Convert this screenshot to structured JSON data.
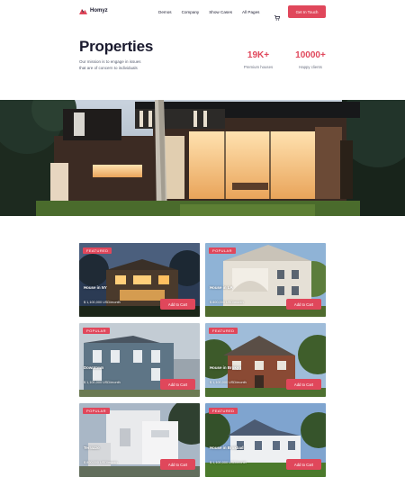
{
  "brand": {
    "name": "Homyz",
    "accent": "#e0475b"
  },
  "nav": {
    "items": [
      "Demos",
      "Company",
      "Show Cases",
      "All Pages"
    ],
    "cart_icon": "cart-icon",
    "cta_label": "Get In Touch"
  },
  "hero": {
    "title": "Properties",
    "mission_line1": "Our mission is to engage in issues",
    "mission_line2": "that are of concern to individuals",
    "stats": [
      {
        "value": "19K+",
        "label": "Premium houses"
      },
      {
        "value": "10000+",
        "label": "Happy clients"
      }
    ]
  },
  "properties": [
    {
      "tag": "FEATURED",
      "name": "House in NY",
      "price": "$ 1,100,000 USD/month",
      "button": "Add to Cart"
    },
    {
      "tag": "POPULAR",
      "name": "House in LA",
      "price": "$ 800,000 USD/month",
      "button": "Add to Cart"
    },
    {
      "tag": "POPULAR",
      "name": "Downtown",
      "price": "$ 1,100,000 USD/month",
      "button": "Add to Cart"
    },
    {
      "tag": "FEATURED",
      "name": "House in Brokyn",
      "price": "$ 1,100,000 USD/month",
      "button": "Add to Cart"
    },
    {
      "tag": "POPULAR",
      "name": "Terrazzo",
      "price": "$ 800,000 USD/month",
      "button": "Add to Cart"
    },
    {
      "tag": "FEATURED",
      "name": "House in Brokbad",
      "price": "$ 1,100,000 USD/month",
      "button": "Add to Cart"
    }
  ]
}
